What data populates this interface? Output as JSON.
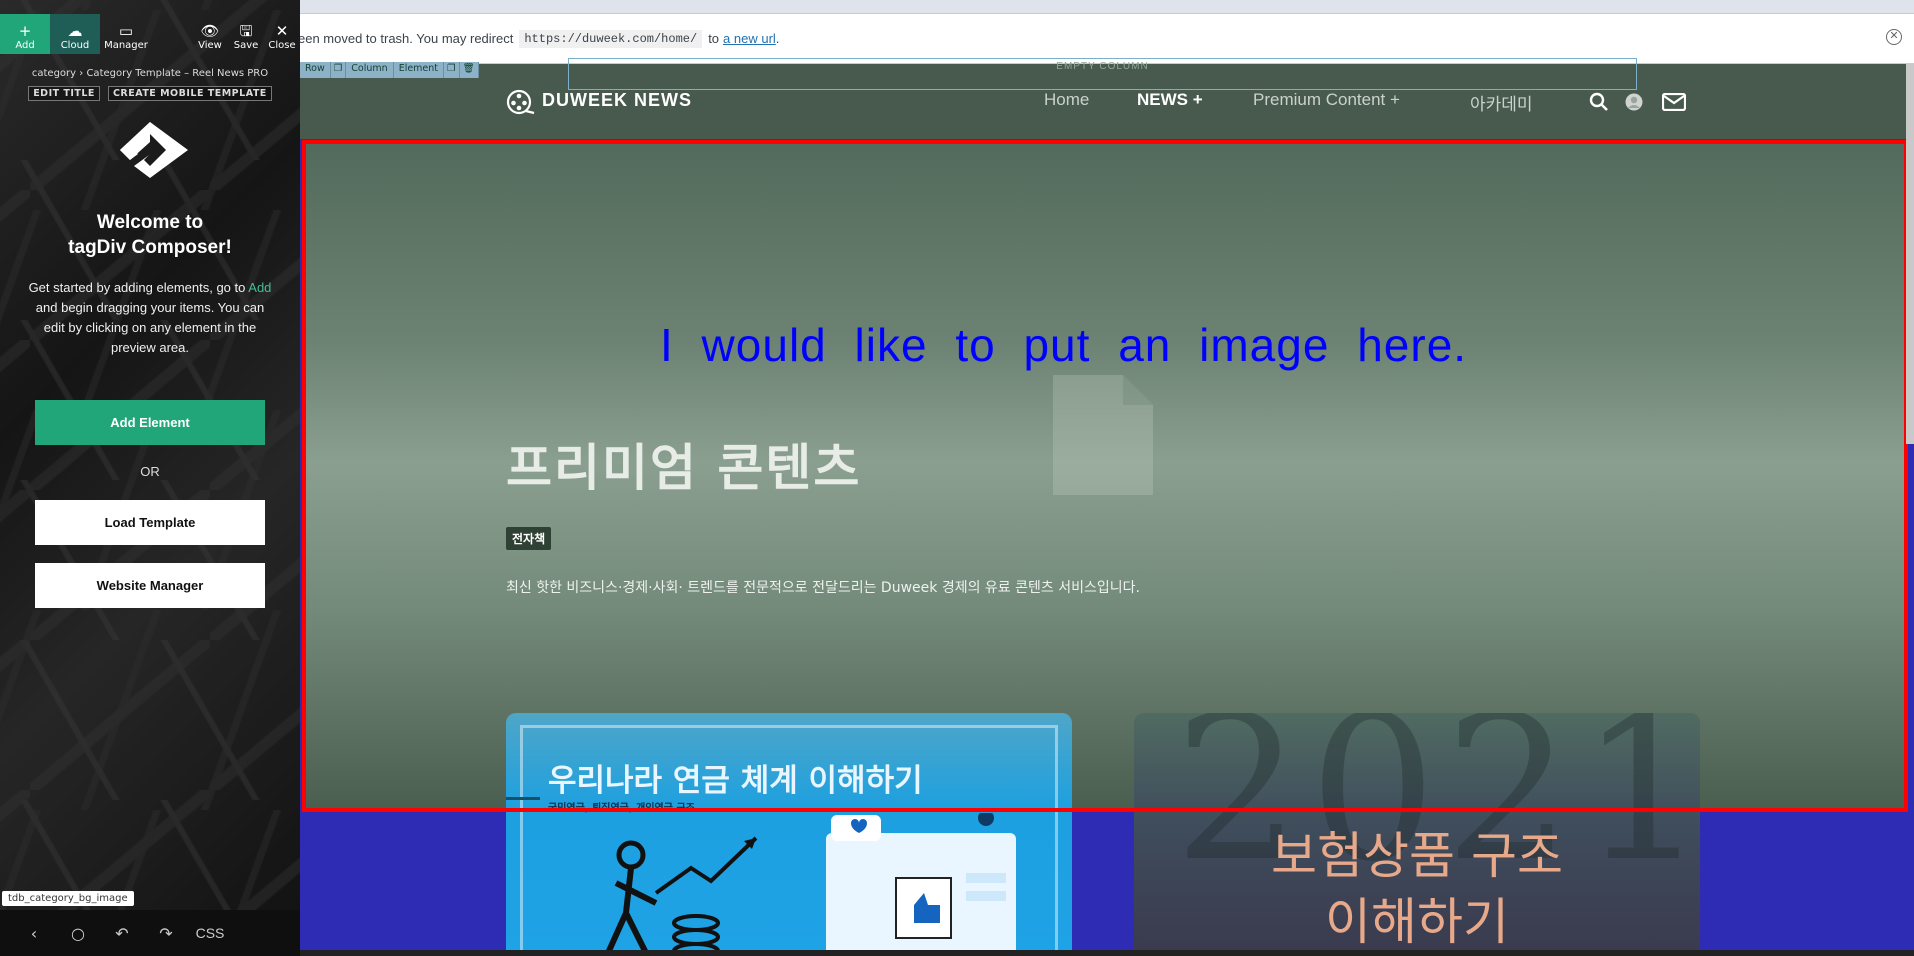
{
  "sidebar": {
    "topbar": {
      "add": "Add",
      "cloud": "Cloud",
      "manager": "Manager",
      "view": "View",
      "save": "Save",
      "close": "Close"
    },
    "breadcrumb": {
      "root": "category",
      "separator": "›",
      "current": "Category Template – Reel News PRO"
    },
    "actions": {
      "edit_title": "EDIT TITLE",
      "create_mobile": "CREATE MOBILE TEMPLATE"
    },
    "welcome": {
      "line1": "Welcome to",
      "line2": "tagDiv Composer!"
    },
    "intro": {
      "before": "Get started by adding elements, go to",
      "link": "Add",
      "after": "and begin dragging your items. You can edit by clicking on any element in the preview area."
    },
    "add_element_label": "Add Element",
    "or_label": "OR",
    "load_template_label": "Load Template",
    "website_manager_label": "Website Manager",
    "selected_element": "tdb_category_bg_image",
    "bottom": {
      "css_label": "CSS"
    },
    "colors": {
      "accent": "#21a67a",
      "cloud": "#1f5e57"
    }
  },
  "notice": {
    "text": "een moved to trash. You may redirect",
    "code": "https://duweek.com/home/",
    "to": "to",
    "link": "a new url",
    "end": ".",
    "dismiss_icon": "close-circle-icon"
  },
  "builder_toolbar": {
    "row": "Row",
    "column": "Column",
    "element": "Element",
    "empty_column": "EMPTY COLUMN"
  },
  "site_header": {
    "name": "DUWEEK NEWS",
    "nav": [
      {
        "label": "Home"
      },
      {
        "label": "NEWS",
        "suffix": "+"
      },
      {
        "label": "Premium Content",
        "suffix": "+"
      },
      {
        "label": "아카데미"
      }
    ],
    "icons": [
      "search-icon",
      "user-avatar-icon",
      "mail-icon"
    ]
  },
  "hero": {
    "annotation": "I would like to put an image here.",
    "title": "프리미엄 콘텐츠",
    "tag": "전자책",
    "description": "최신 핫한 비즈니스·경제·사회· 트렌드를 전문적으로 전달드리는 Duweek 경제의 유료 콘텐츠 서비스입니다.",
    "highlight_color": "#ff0000",
    "annotation_color": "#0000ff"
  },
  "cards": [
    {
      "title": "우리나라 연금 체계 이해하기",
      "subtitle": "국민연금, 퇴직연금, 개인연금 구조"
    },
    {
      "title_line1": "보험상품 구조",
      "title_line2": "이해하기",
      "bg_text": "2021"
    }
  ]
}
